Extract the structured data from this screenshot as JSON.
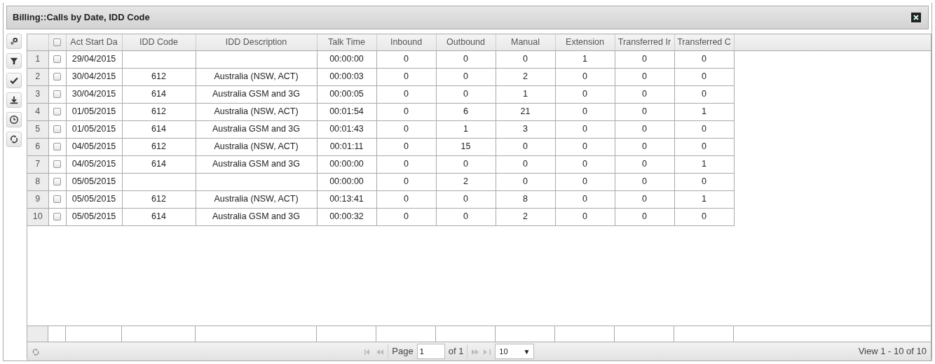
{
  "window": {
    "title": "Billing::Calls by Date, IDD Code"
  },
  "toolbar": [
    {
      "kind": "columns"
    },
    {
      "kind": "filter"
    },
    {
      "kind": "check"
    },
    {
      "kind": "download"
    },
    {
      "kind": "clock"
    },
    {
      "kind": "refresh"
    }
  ],
  "table": {
    "columns": [
      "Act Start Da",
      "IDD Code",
      "IDD Description",
      "Talk Time",
      "Inbound",
      "Outbound",
      "Manual",
      "Extension",
      "Transferred Ir",
      "Transferred C"
    ],
    "all_checked": false,
    "rows": [
      {
        "number": "1",
        "checked": false,
        "cells": [
          "29/04/2015",
          "",
          "",
          "00:00:00",
          "0",
          "0",
          "0",
          "1",
          "0",
          "0"
        ]
      },
      {
        "number": "2",
        "checked": false,
        "cells": [
          "30/04/2015",
          "612",
          "Australia (NSW, ACT)",
          "00:00:03",
          "0",
          "0",
          "2",
          "0",
          "0",
          "0"
        ]
      },
      {
        "number": "3",
        "checked": false,
        "cells": [
          "30/04/2015",
          "614",
          "Australia GSM and 3G",
          "00:00:05",
          "0",
          "0",
          "1",
          "0",
          "0",
          "0"
        ]
      },
      {
        "number": "4",
        "checked": false,
        "cells": [
          "01/05/2015",
          "612",
          "Australia (NSW, ACT)",
          "00:01:54",
          "0",
          "6",
          "21",
          "0",
          "0",
          "1"
        ]
      },
      {
        "number": "5",
        "checked": false,
        "cells": [
          "01/05/2015",
          "614",
          "Australia GSM and 3G",
          "00:01:43",
          "0",
          "1",
          "3",
          "0",
          "0",
          "0"
        ]
      },
      {
        "number": "6",
        "checked": false,
        "cells": [
          "04/05/2015",
          "612",
          "Australia (NSW, ACT)",
          "00:01:11",
          "0",
          "15",
          "0",
          "0",
          "0",
          "0"
        ]
      },
      {
        "number": "7",
        "checked": false,
        "cells": [
          "04/05/2015",
          "614",
          "Australia GSM and 3G",
          "00:00:00",
          "0",
          "0",
          "0",
          "0",
          "0",
          "1"
        ]
      },
      {
        "number": "8",
        "checked": false,
        "cells": [
          "05/05/2015",
          "",
          "",
          "00:00:00",
          "0",
          "2",
          "0",
          "0",
          "0",
          "0"
        ]
      },
      {
        "number": "9",
        "checked": false,
        "cells": [
          "05/05/2015",
          "612",
          "Australia (NSW, ACT)",
          "00:13:41",
          "0",
          "0",
          "8",
          "0",
          "0",
          "1"
        ]
      },
      {
        "number": "10",
        "checked": false,
        "cells": [
          "05/05/2015",
          "614",
          "Australia GSM and 3G",
          "00:00:32",
          "0",
          "0",
          "2",
          "0",
          "0",
          "0"
        ]
      }
    ]
  },
  "pager": {
    "page_label": "Page",
    "page": "1",
    "of_label": "of 1",
    "page_size": "10",
    "caret": "▼",
    "summary": "View 1 - 10 of 10"
  }
}
